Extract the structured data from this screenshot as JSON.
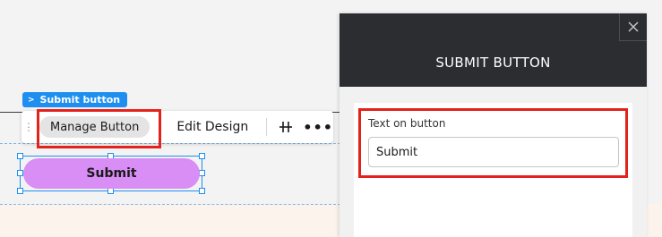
{
  "selection_tag": {
    "label": "Submit button",
    "icon": "chevron-right-icon"
  },
  "toolbar": {
    "manage_label": "Manage Button",
    "edit_design_label": "Edit Design",
    "stretch_icon": "stretch-icon",
    "more_icon": "more-horizontal-icon",
    "drag_icon": "drag-handle-icon"
  },
  "canvas_button": {
    "label": "Submit",
    "color": "#d98ef5"
  },
  "panel": {
    "title": "SUBMIT BUTTON",
    "close_icon": "close-icon",
    "field_label": "Text on button",
    "field_value": "Submit"
  },
  "colors": {
    "accent": "#1e8ff0",
    "highlight": "#e3231b",
    "panel_header": "#2b2d30"
  }
}
